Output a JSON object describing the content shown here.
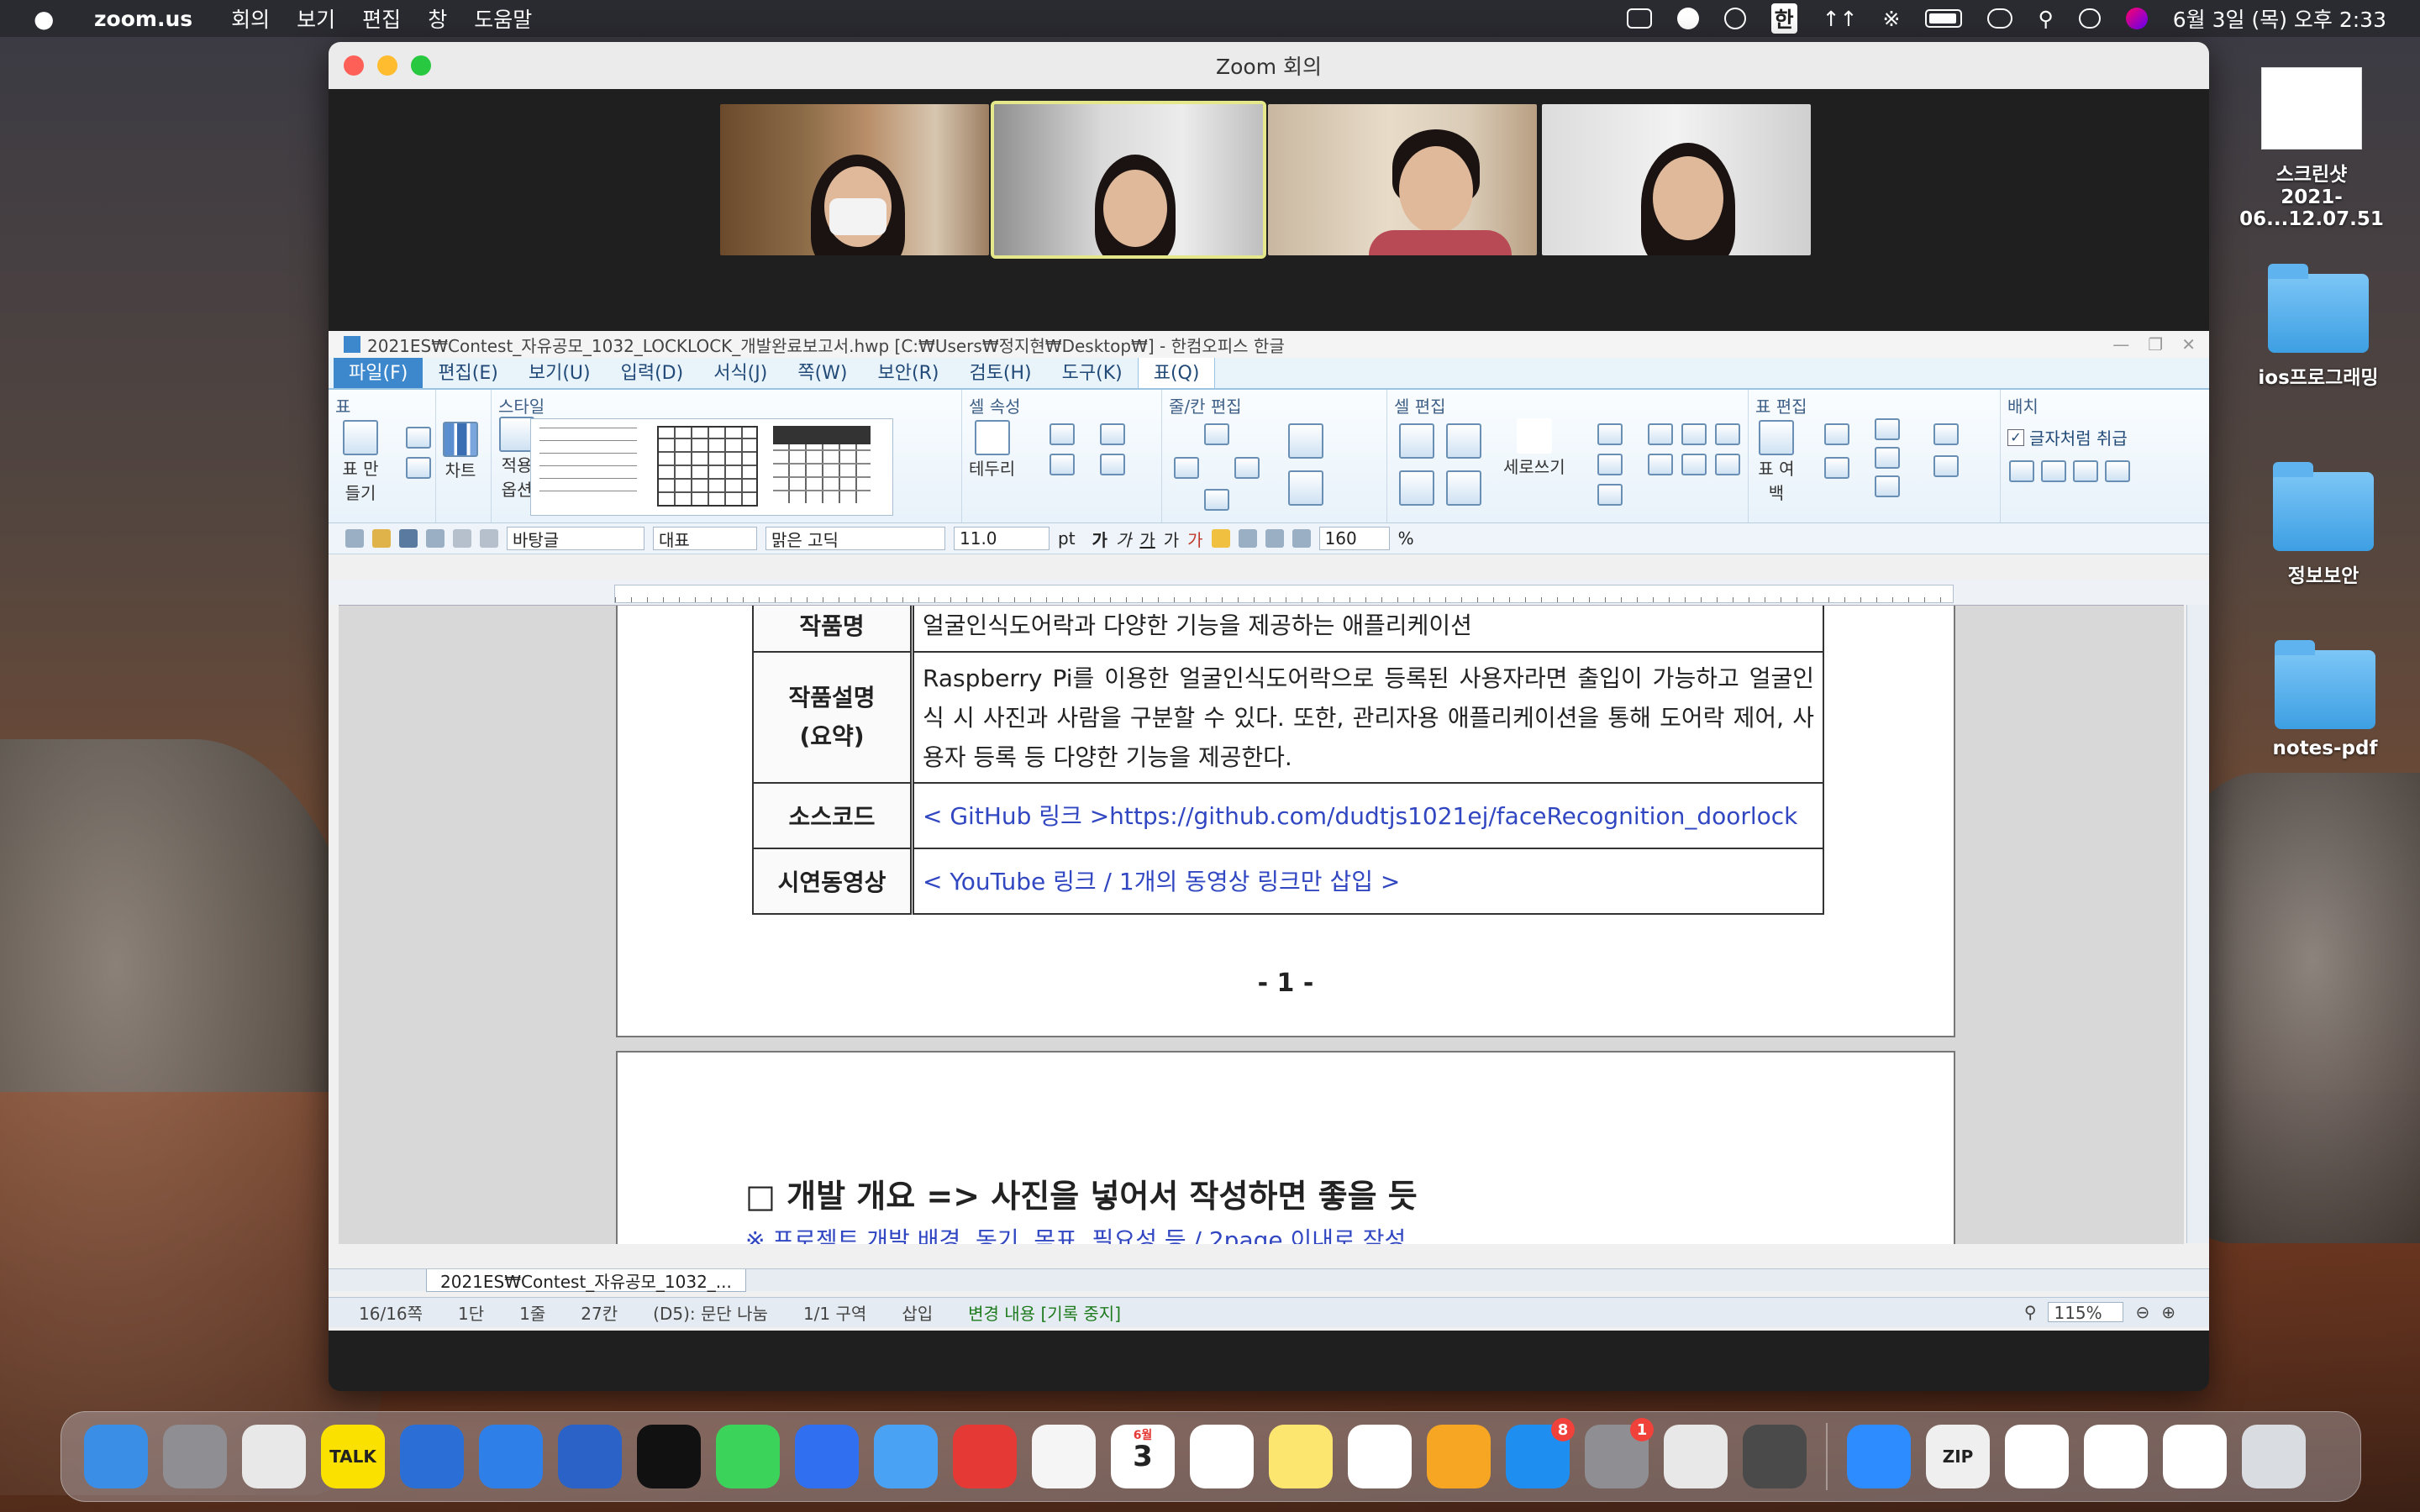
{
  "menubar": {
    "app_name": "zoom.us",
    "items": [
      "회의",
      "보기",
      "편집",
      "창",
      "도움말"
    ],
    "clock": "6월 3일 (목) 오후 2:33",
    "ime": "한"
  },
  "zoom": {
    "window_title": "Zoom 회의",
    "participants": [
      {
        "tile": "participant-1"
      },
      {
        "tile": "participant-2",
        "active": true
      },
      {
        "tile": "participant-3"
      },
      {
        "tile": "participant-4"
      }
    ]
  },
  "hwp": {
    "title": "2021ES₩Contest_자유공모_1032_LOCKLOCK_개발완료보고서.hwp [C:₩Users₩정지현₩Desktop₩] - 한컴오피스 한글",
    "menu": [
      "파일(F)",
      "편집(E)",
      "보기(U)",
      "입력(D)",
      "서식(J)",
      "쪽(W)",
      "보안(R)",
      "검토(H)",
      "도구(K)",
      "표(Q)"
    ],
    "ribbon": {
      "groups": [
        "표",
        "스타일",
        "셀 속성",
        "줄/칸 편집",
        "셀 편집",
        "표 편집",
        "배치"
      ],
      "make_table": "표 만들기",
      "chart": "차트",
      "apply_options": "적용 옵션",
      "border": "테두리",
      "vertical_writing": "세로쓰기",
      "table_margin": "표 여백",
      "treat_as_char": "글자처럼 취급"
    },
    "toolbar": {
      "style": "바탕글",
      "lang": "대표",
      "font": "맑은 고딕",
      "size": "11.0",
      "unit": "pt",
      "spacing": "160",
      "percent": "%",
      "format_chars": [
        "가",
        "가",
        "가",
        "가",
        "가"
      ]
    },
    "doc": {
      "rows": [
        {
          "label": "작품명",
          "text": "얼굴인식도어락과 다양한 기능을 제공하는 애플리케이션"
        },
        {
          "label": "작품설명\n(요약)",
          "text": "Raspberry Pi를 이용한 얼굴인식도어락으로 등록된 사용자라면 출입이 가능하고 얼굴인식 시 사진과 사람을 구분할 수 있다. 또한, 관리자용 애플리케이션을 통해 도어락 제어, 사용자 등록 등 다양한 기능을 제공한다."
        },
        {
          "label": "소스코드",
          "text": "< GitHub 링크 >https://github.com/dudtjs1021ej/faceRecognition_doorlock"
        },
        {
          "label": "시연동영상",
          "text": "< YouTube 링크 / 1개의 동영상 링크만 삽입 >"
        }
      ],
      "page_number": "- 1 -",
      "section_title": "□ 개발 개요 => 사진을 넣어서 작성하면 좋을 듯",
      "section_note": "※ 프로젝트 개발 배경, 동기, 목표, 필요성 등 / 2page 이내로 작성"
    },
    "tab_label": "2021ES₩Contest_자유공모_1032_...",
    "status": [
      "16/16쪽",
      "1단",
      "1줄",
      "27칸",
      "(D5): 문단 나눔",
      "1/1 구역",
      "삽입"
    ],
    "status_change": "변경 내용 [기록 중지]",
    "zoom_level": "115%"
  },
  "desktop": {
    "items": [
      {
        "label": "스크린샷\n2021-06...12.07.51",
        "kind": "screenshot"
      },
      {
        "label": "ios프로그래밍",
        "kind": "folder"
      },
      {
        "label": "정보보안",
        "kind": "folder"
      },
      {
        "label": "notes-pdf",
        "kind": "folder"
      }
    ]
  },
  "dock": {
    "apps": [
      {
        "name": "Finder",
        "color": "#3a8ee6"
      },
      {
        "name": "Launchpad",
        "color": "#8e8e93"
      },
      {
        "name": "Chrome",
        "color": "#e8e8e8"
      },
      {
        "name": "KakaoTalk",
        "color": "#fae100",
        "text": "TALK"
      },
      {
        "name": "Xcode Helper",
        "color": "#2b6fd6"
      },
      {
        "name": "Xcode",
        "color": "#2f7fe8"
      },
      {
        "name": "Instruments",
        "color": "#2a62c8"
      },
      {
        "name": "Terminal",
        "color": "#111111"
      },
      {
        "name": "Messages",
        "color": "#3cd35a"
      },
      {
        "name": "Maps",
        "color": "#2f6ff0"
      },
      {
        "name": "Mail",
        "color": "#4aa2f4"
      },
      {
        "name": "Player",
        "color": "#e53935"
      },
      {
        "name": "Photos",
        "color": "#f5f5f5"
      },
      {
        "name": "Calendar",
        "color": "#ffffff",
        "text": "3",
        "sub": "6월"
      },
      {
        "name": "Reminders",
        "color": "#ffffff"
      },
      {
        "name": "Notes",
        "color": "#fde66f"
      },
      {
        "name": "Keynote",
        "color": "#ffffff"
      },
      {
        "name": "Pages",
        "color": "#f6a623"
      },
      {
        "name": "App Store",
        "color": "#1f8ef1",
        "badge": "8"
      },
      {
        "name": "System Preferences",
        "color": "#8e8e93",
        "badge": "1"
      },
      {
        "name": "Chrome 2",
        "color": "#e8e8e8"
      },
      {
        "name": "QuickTime",
        "color": "#4a4a4a"
      },
      {
        "name": "Zoom",
        "color": "#2d8cff"
      },
      {
        "name": "Archive",
        "color": "#efefef",
        "text": "ZIP"
      },
      {
        "name": "Doc 1",
        "color": "#ffffff"
      },
      {
        "name": "Doc 2",
        "color": "#ffffff"
      },
      {
        "name": "Doc 3",
        "color": "#ffffff"
      },
      {
        "name": "Trash",
        "color": "#d9dde2"
      }
    ]
  }
}
